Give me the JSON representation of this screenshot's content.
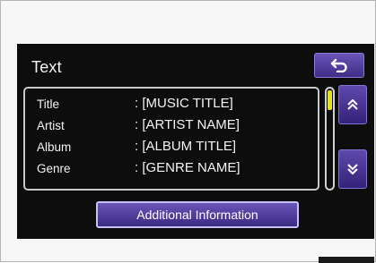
{
  "screen": {
    "title": "Text",
    "rows": [
      {
        "label": "Title",
        "value": ": [MUSIC TITLE]"
      },
      {
        "label": "Artist",
        "value": ": [ARTIST NAME]"
      },
      {
        "label": "Album",
        "value": ": [ALBUM TITLE]"
      },
      {
        "label": "Genre",
        "value": ": [GENRE NAME]"
      }
    ],
    "additional_button_label": "Additional Information"
  },
  "icons": {
    "back": "return-arrow-icon",
    "scroll_up": "double-chevron-up-icon",
    "scroll_down": "double-chevron-down-icon"
  },
  "colors": {
    "screen_bg": "#0d0d0d",
    "button_purple": "#4b3a9a",
    "scroll_thumb": "#e6e60a"
  }
}
